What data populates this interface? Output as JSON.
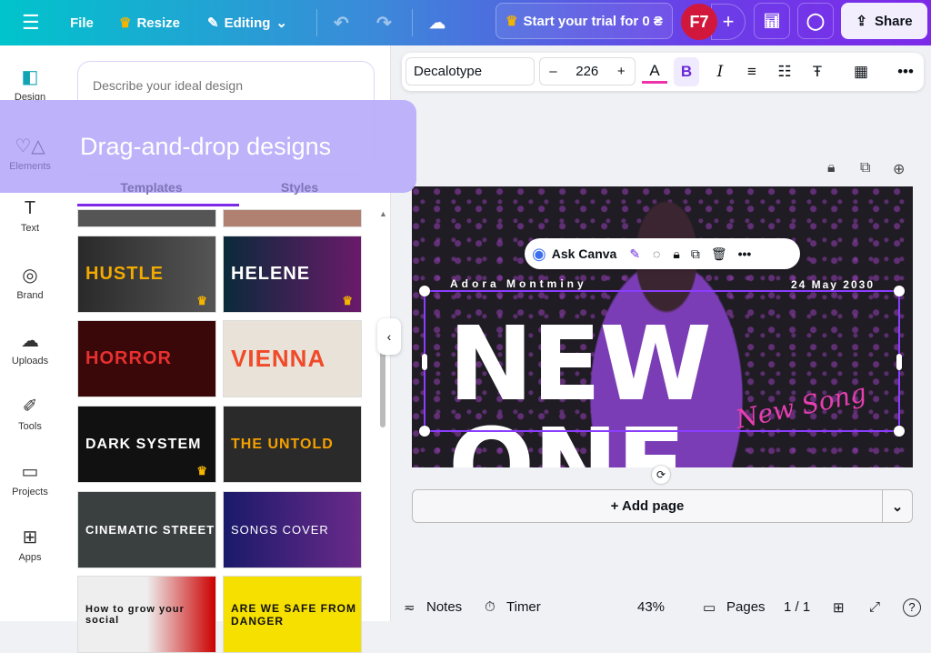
{
  "topbar": {
    "menu_icon": "hamburger-icon",
    "file": "File",
    "resize": "Resize",
    "editing": "Editing",
    "trial": "Start your trial for 0 ₴",
    "avatar": "F7",
    "share": "Share"
  },
  "rail": [
    {
      "label": "Design"
    },
    {
      "label": "Elements"
    },
    {
      "label": "Text"
    },
    {
      "label": "Brand"
    },
    {
      "label": "Uploads"
    },
    {
      "label": "Tools"
    },
    {
      "label": "Projects"
    },
    {
      "label": "Apps"
    }
  ],
  "panel": {
    "prompt_placeholder": "Describe your ideal design",
    "tabs": [
      "Templates",
      "Styles"
    ],
    "templates": [
      {
        "title": "HUSTLE",
        "premium": true
      },
      {
        "title": "HELENE",
        "premium": true
      },
      {
        "title": "HORROR",
        "premium": false
      },
      {
        "title": "VIENNA",
        "premium": false
      },
      {
        "title": "DARK SYSTEM",
        "premium": true
      },
      {
        "title": "THE UNTOLD",
        "premium": false
      },
      {
        "title": "CINEMATIC STREET",
        "premium": false
      },
      {
        "title": "SONGS COVER",
        "premium": false
      },
      {
        "title": "How to grow your social",
        "premium": false
      },
      {
        "title": "ARE WE SAFE FROM DANGER",
        "premium": false
      }
    ]
  },
  "overlay": {
    "text": "Drag-and-drop designs"
  },
  "format": {
    "font": "Decalotype",
    "size": "226",
    "bold": "B",
    "italic": "I"
  },
  "floating": {
    "ask": "Ask Canva"
  },
  "design": {
    "artist": "Adora Montminy",
    "date": "24 May 2030",
    "title": "NEW ONE",
    "subtitle": "New Song"
  },
  "add_page": "+ Add page",
  "footer": {
    "notes": "Notes",
    "timer": "Timer",
    "zoom": "43%",
    "pages": "Pages",
    "page_count": "1 / 1"
  },
  "colors": {
    "accent": "#7d2ae8",
    "avatar": "#d1183c"
  }
}
